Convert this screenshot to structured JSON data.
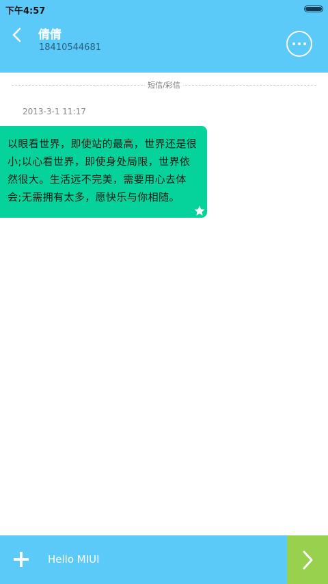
{
  "status_bar": {
    "time": "下午4:57",
    "battery_level": 1.0
  },
  "header": {
    "contact_name": "倩倩",
    "contact_number": "18410544681",
    "back_icon": "chevron-left-icon",
    "more_icon": "more-options-icon"
  },
  "conversation": {
    "divider_label": "短信/彩信",
    "messages": [
      {
        "timestamp": "2013-3-1 11:17",
        "text": "以眼看世界，即使站的最高，世界还是很小;以心看世界，即使身处局限，世界依然很大。生活远不完美，需要用心去体会;无需拥有太多，愿快乐与你相随。",
        "starred": true
      }
    ]
  },
  "composer": {
    "add_icon": "plus-icon",
    "input_value": "Hello MIUI",
    "send_icon": "chevron-right-icon"
  },
  "colors": {
    "header_bg": "#5ccaf8",
    "bubble_bg": "#06d39b",
    "send_bg": "#97d14d"
  }
}
